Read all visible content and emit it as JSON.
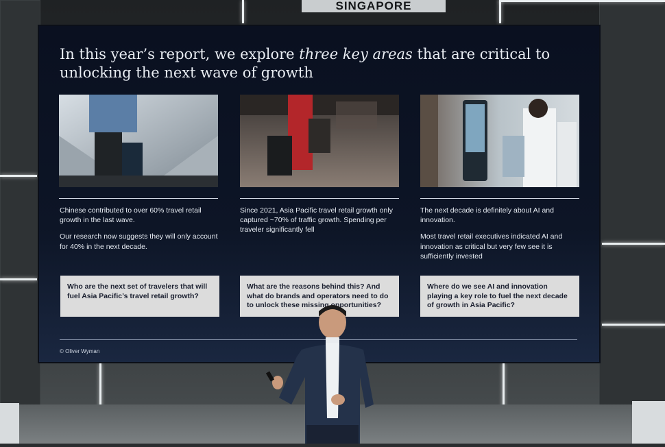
{
  "venue_sign": "SINGAPORE",
  "slide": {
    "headline_before": "In this year’s report, we explore ",
    "headline_emphasis": "three key areas",
    "headline_after": " that are critical to unlocking the next wave of growth",
    "columns": [
      {
        "photo_icon": "traveler-escalator-photo",
        "paragraphs": [
          "Chinese contributed to over 60% travel retail growth in the last wave.",
          "Our research now suggests they will only account for 40% in the next decade."
        ],
        "question": "Who are the next set of travelers that will fuel Asia Pacific’s travel retail growth?"
      },
      {
        "photo_icon": "airport-luggage-photo",
        "paragraphs": [
          "Since 2021, Asia Pacific travel retail growth only captured ~70% of traffic growth. Spending per traveler significantly fell"
        ],
        "question": "What are the reasons behind this? And what do brands and operators need to do to unlock these missing opportunities?"
      },
      {
        "photo_icon": "shopper-digital-screen-photo",
        "paragraphs": [
          "The next decade is definitely about AI and innovation.",
          "Most travel retail executives indicated AI and innovation as critical but very few see it is sufficiently invested"
        ],
        "question": "Where do we see AI and innovation playing a key role to fuel the next decade of growth in Asia Pacific?"
      }
    ],
    "copyright": "© Oliver Wyman"
  },
  "colors": {
    "screen_bg": "#0a1020",
    "question_box": "#dcdcdc",
    "text": "#e6ebf2"
  }
}
